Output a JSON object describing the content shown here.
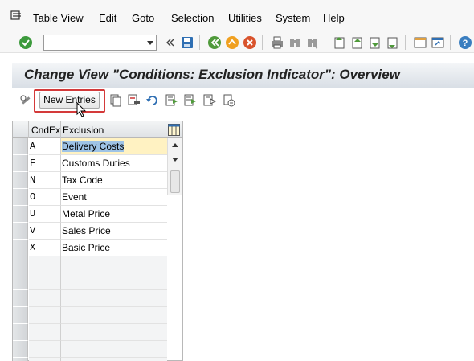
{
  "menu": {
    "items": [
      "Table View",
      "Edit",
      "Goto",
      "Selection",
      "Utilities",
      "System",
      "Help"
    ]
  },
  "toolbar": {
    "command_field_value": "",
    "icons": [
      "enter-icon",
      "command-dropdown-icon",
      "collapse-icon",
      "save-icon",
      "back-icon",
      "exit-icon",
      "cancel-icon",
      "print-icon",
      "find-icon",
      "find-next-icon",
      "first-page-icon",
      "previous-page-icon",
      "next-page-icon",
      "last-page-icon",
      "create-session-icon",
      "shortcut-icon",
      "help-icon"
    ]
  },
  "title": {
    "text": "Change View \"Conditions: Exclusion Indicator\": Overview"
  },
  "app_toolbar": {
    "new_entries_label": "New Entries",
    "icons": [
      "display-change-icon",
      "copy-as-icon",
      "delete-icon",
      "undo-change-icon",
      "select-all-icon",
      "select-block-icon",
      "deselect-all-icon",
      "choose-icon"
    ]
  },
  "table": {
    "columns": [
      "CndEx",
      "Exclusion"
    ],
    "rows": [
      {
        "code": "A",
        "exclusion": "Delivery Costs"
      },
      {
        "code": "F",
        "exclusion": "Customs Duties"
      },
      {
        "code": "N",
        "exclusion": "Tax Code"
      },
      {
        "code": "O",
        "exclusion": "Event"
      },
      {
        "code": "U",
        "exclusion": "Metal Price"
      },
      {
        "code": "V",
        "exclusion": "Sales Price"
      },
      {
        "code": "X",
        "exclusion": "Basic Price"
      }
    ],
    "empty_rows": 7
  },
  "colors": {
    "highlight_box": "#d43a3a",
    "selected_text_bg": "#9ec3e6",
    "active_cell_bg": "#fff2c2"
  }
}
